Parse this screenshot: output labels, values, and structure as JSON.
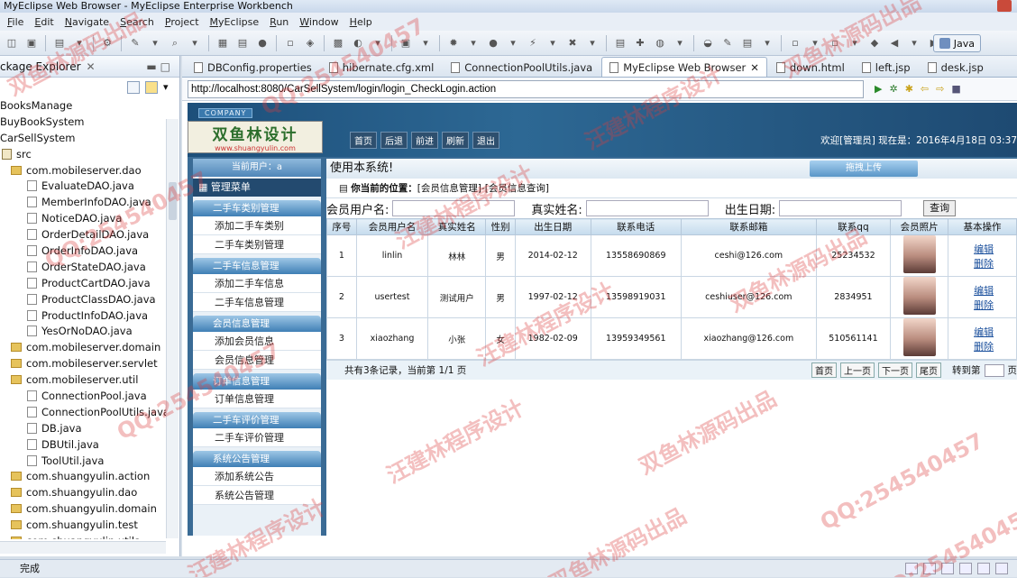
{
  "window": {
    "title": "MyEclipse Web Browser - MyEclipse Enterprise Workbench"
  },
  "menu": [
    "File",
    "Edit",
    "Navigate",
    "Search",
    "Project",
    "MyEclipse",
    "Run",
    "Window",
    "Help"
  ],
  "perspective": {
    "label": "Java"
  },
  "explorer": {
    "title": "Package Explorer",
    "items": [
      {
        "label": "BooksManage",
        "type": "project",
        "indent": 0
      },
      {
        "label": "BuyBookSystem",
        "type": "project",
        "indent": 0
      },
      {
        "label": "CarSellSystem",
        "type": "project",
        "indent": 0
      },
      {
        "label": "src",
        "type": "folder",
        "indent": 1
      },
      {
        "label": "com.mobileserver.dao",
        "type": "package",
        "indent": 2
      },
      {
        "label": "EvaluateDAO.java",
        "type": "java",
        "indent": 3
      },
      {
        "label": "MemberInfoDAO.java",
        "type": "java",
        "indent": 3
      },
      {
        "label": "NoticeDAO.java",
        "type": "java",
        "indent": 3
      },
      {
        "label": "OrderDetailDAO.java",
        "type": "java",
        "indent": 3
      },
      {
        "label": "OrderInfoDAO.java",
        "type": "java",
        "indent": 3
      },
      {
        "label": "OrderStateDAO.java",
        "type": "java",
        "indent": 3
      },
      {
        "label": "ProductCartDAO.java",
        "type": "java",
        "indent": 3
      },
      {
        "label": "ProductClassDAO.java",
        "type": "java",
        "indent": 3
      },
      {
        "label": "ProductInfoDAO.java",
        "type": "java",
        "indent": 3
      },
      {
        "label": "YesOrNoDAO.java",
        "type": "java",
        "indent": 3
      },
      {
        "label": "com.mobileserver.domain",
        "type": "package",
        "indent": 2
      },
      {
        "label": "com.mobileserver.servlet",
        "type": "package",
        "indent": 2
      },
      {
        "label": "com.mobileserver.util",
        "type": "package",
        "indent": 2
      },
      {
        "label": "ConnectionPool.java",
        "type": "java",
        "indent": 3
      },
      {
        "label": "ConnectionPoolUtils.java",
        "type": "java",
        "indent": 3
      },
      {
        "label": "DB.java",
        "type": "java",
        "indent": 3
      },
      {
        "label": "DBUtil.java",
        "type": "java",
        "indent": 3
      },
      {
        "label": "ToolUtil.java",
        "type": "java",
        "indent": 3
      },
      {
        "label": "com.shuangyulin.action",
        "type": "package",
        "indent": 2
      },
      {
        "label": "com.shuangyulin.dao",
        "type": "package",
        "indent": 2
      },
      {
        "label": "com.shuangyulin.domain",
        "type": "package",
        "indent": 2
      },
      {
        "label": "com.shuangyulin.test",
        "type": "package",
        "indent": 2
      },
      {
        "label": "com.shuangyulin.utils",
        "type": "package",
        "indent": 2
      }
    ]
  },
  "tabs": [
    {
      "label": "DBConfig.properties",
      "active": false
    },
    {
      "label": "hibernate.cfg.xml",
      "active": false
    },
    {
      "label": "ConnectionPoolUtils.java",
      "active": false
    },
    {
      "label": "MyEclipse Web Browser",
      "active": true
    },
    {
      "label": "down.html",
      "active": false
    },
    {
      "label": "left.jsp",
      "active": false
    },
    {
      "label": "desk.jsp",
      "active": false
    }
  ],
  "browser": {
    "url": "http://localhost:8080/CarSellSystem/login/login_CheckLogin.action"
  },
  "site": {
    "company": "COMPANY",
    "logo": "双鱼林设计",
    "logo_sub": "www.shuangyulin.com",
    "nav": [
      "首页",
      "后退",
      "前进",
      "刷新",
      "退出"
    ],
    "welcome": "欢迎[管理员]  现在是：2016年4月18日 03:37",
    "current_user": "当前用户：a",
    "menu_title": "管理菜单",
    "sections": [
      {
        "title": "二手车类别管理",
        "items": [
          "添加二手车类别",
          "二手车类别管理"
        ]
      },
      {
        "title": "二手车信息管理",
        "items": [
          "添加二手车信息",
          "二手车信息管理"
        ]
      },
      {
        "title": "会员信息管理",
        "items": [
          "添加会员信息",
          "会员信息管理"
        ]
      },
      {
        "title": "订单信息管理",
        "items": [
          "订单信息管理"
        ]
      },
      {
        "title": "二手车评价管理",
        "items": [
          "二手车评价管理"
        ]
      },
      {
        "title": "系统公告管理",
        "items": [
          "添加系统公告",
          "系统公告管理"
        ]
      }
    ],
    "content_title": "使用本系统!",
    "drag_label": "拖拽上传",
    "location_label": "你当前的位置：",
    "location": "[会员信息管理]-[会员信息查询]",
    "search": {
      "username_label": "会员用户名:",
      "realname_label": "真实姓名:",
      "birth_label": "出生日期:",
      "button": "查询"
    },
    "table": {
      "headers": [
        "序号",
        "会员用户名",
        "真实姓名",
        "性别",
        "出生日期",
        "联系电话",
        "联系邮箱",
        "联系qq",
        "会员照片",
        "基本操作"
      ],
      "rows": [
        [
          "1",
          "linlin",
          "林林",
          "男",
          "2014-02-12",
          "13558690869",
          "ceshi@126.com",
          "25234532"
        ],
        [
          "2",
          "usertest",
          "测试用户",
          "男",
          "1997-02-12",
          "13598919031",
          "ceshiuser@126.com",
          "2834951"
        ],
        [
          "3",
          "xiaozhang",
          "小张",
          "女",
          "1982-02-09",
          "13959349561",
          "xiaozhang@126.com",
          "510561141"
        ]
      ],
      "edit": "编辑",
      "delete": "删除"
    },
    "pager": {
      "summary": "共有3条记录，当前第 1/1 页",
      "first": "首页",
      "prev": "上一页",
      "next": "下一页",
      "last": "尾页",
      "goto": "转到第",
      "page": "页"
    }
  },
  "status": {
    "text": "完成"
  },
  "watermarks": [
    "双鱼林源码出品",
    "QQ:254540457",
    "汪建林程序设计"
  ]
}
